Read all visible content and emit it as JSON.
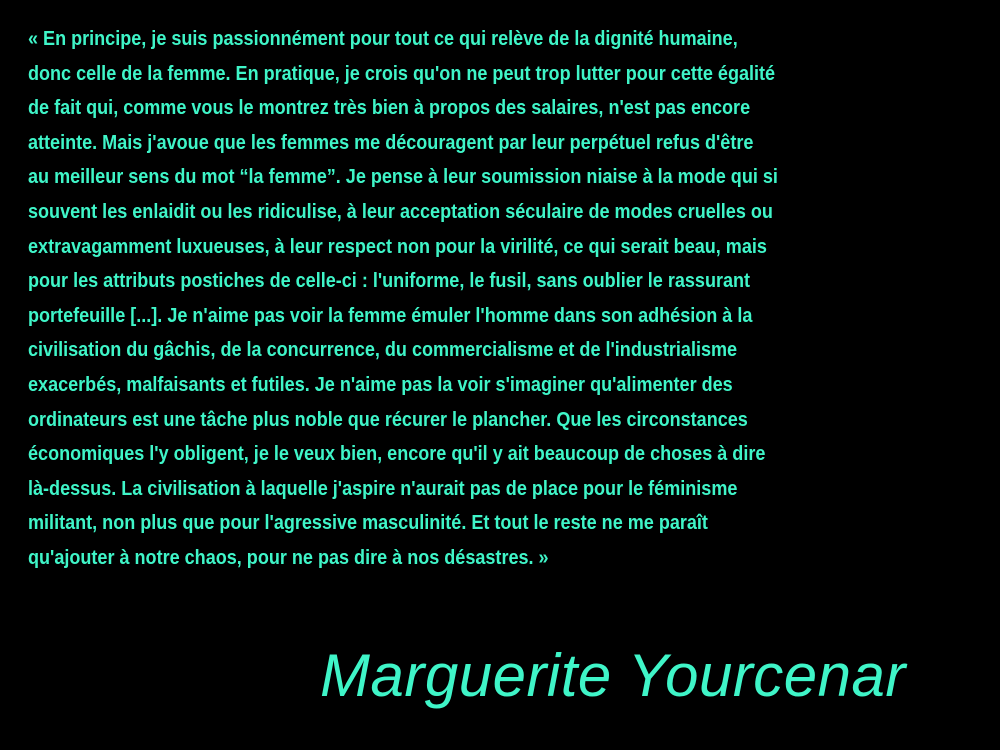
{
  "colors": {
    "background": "#000000",
    "text": "#3ff5c8"
  },
  "quote": {
    "lines": [
      "« En principe, je suis passionnément pour tout ce qui relève de la dignité humaine,",
      "donc celle de la femme. En pratique, je crois qu'on ne peut trop lutter pour cette égalité",
      "de fait qui, comme vous le montrez très bien à propos des salaires, n'est pas encore",
      "atteinte. Mais j'avoue que les femmes me découragent par leur perpétuel refus d'être",
      "au meilleur sens du mot “la femme”. Je pense à leur soumission niaise à la mode qui si",
      "souvent les enlaidit ou les ridiculise, à leur acceptation séculaire de modes cruelles ou",
      "extravagamment luxueuses, à leur respect non pour la virilité, ce qui serait beau, mais",
      "pour les attributs postiches de celle-ci : l'uniforme, le fusil, sans oublier le rassurant",
      "portefeuille [...]. Je n'aime pas voir la femme émuler l'homme dans son adhésion à la",
      "civilisation du gâchis, de la concurrence, du commercialisme et de l'industrialisme",
      "exacerbés, malfaisants et futiles. Je n'aime pas la voir s'imaginer qu'alimenter des",
      "ordinateurs est une tâche plus noble que récurer le plancher. Que les circonstances",
      "économiques l'y obligent, je le veux bien, encore qu'il y ait beaucoup de choses à dire",
      "là-dessus. La civilisation à laquelle j'aspire n'aurait pas de place pour le féminisme",
      "militant, non plus que pour l'agressive masculinité. Et tout le reste ne me paraît",
      "qu'ajouter à notre chaos, pour ne pas dire à nos désastres. »"
    ]
  },
  "author": "Marguerite Yourcenar"
}
